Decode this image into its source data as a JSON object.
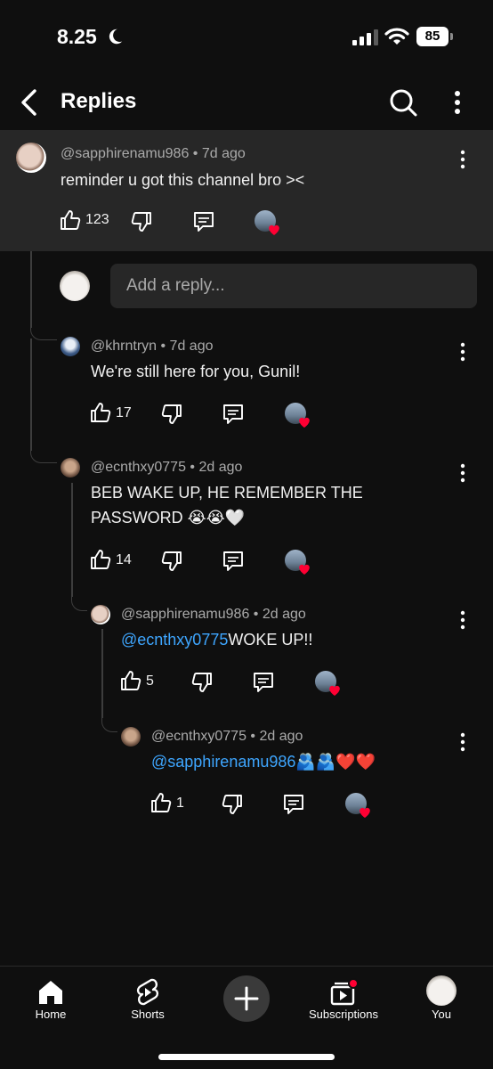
{
  "status": {
    "time": "8.25",
    "battery": "85"
  },
  "header": {
    "title": "Replies"
  },
  "parent": {
    "author": "@sapphirenamu986",
    "age": "7d ago",
    "text": "reminder u got this channel bro ><",
    "likes": "123"
  },
  "reply_box": {
    "placeholder": "Add a reply..."
  },
  "replies": [
    {
      "author": "@khrntryn",
      "age": "7d ago",
      "text": "We're still here for you, Gunil!",
      "likes": "17"
    },
    {
      "author": "@ecnthxy0775",
      "age": "2d ago",
      "text_line1": "BEB WAKE UP, HE REMEMBER THE",
      "text_line2": "PASSWORD 😭😭🤍",
      "likes": "14"
    },
    {
      "author": "@sapphirenamu986",
      "age": "2d ago",
      "mention": "@ecnthxy0775",
      "text": "WOKE UP!!",
      "likes": "5"
    },
    {
      "author": "@ecnthxy0775",
      "age": "2d ago",
      "mention": "@sapphirenamu986",
      "text": "🫂🫂❤️❤️",
      "likes": "1"
    }
  ],
  "nav": {
    "home": "Home",
    "shorts": "Shorts",
    "subscriptions": "Subscriptions",
    "you": "You"
  },
  "colors": {
    "background": "#0f0f0f",
    "highlight": "#272727",
    "mention": "#3ea6ff",
    "heart": "#ff0033"
  },
  "icons": [
    "back-arrow-icon",
    "search-icon",
    "more-vert-icon",
    "thumb-up-icon",
    "thumb-down-icon",
    "reply-icon",
    "creator-heart-icon",
    "home-icon",
    "shorts-icon",
    "plus-icon",
    "subscriptions-icon"
  ]
}
